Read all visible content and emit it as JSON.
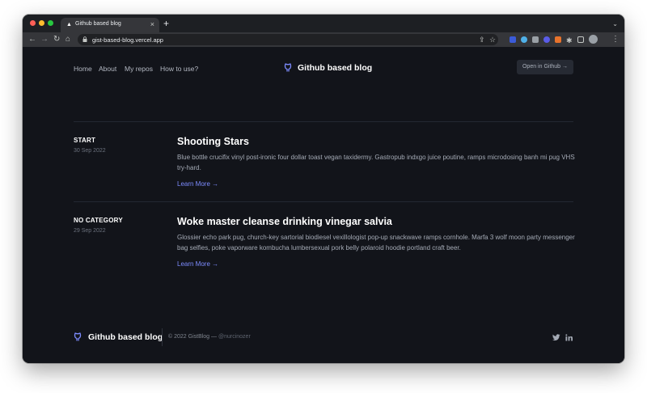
{
  "browser": {
    "tab_title": "Github based blog",
    "tab_favicon": "▲",
    "url": "gist-based-blog.vercel.app",
    "colors": {
      "close": "#ff5f57",
      "minimize": "#febc2e",
      "maximize": "#28c840"
    },
    "icons": [
      "back-icon",
      "forward-icon",
      "reload-icon",
      "home-icon",
      "lock-icon",
      "share-icon",
      "star-icon",
      "extensions-icon",
      "profile-avatar-icon"
    ]
  },
  "site": {
    "nav": [
      "Home",
      "About",
      "My repos",
      "How to use?"
    ],
    "brand": "Github based blog",
    "github_button": "Open in Github →",
    "accent": "#7d8cff"
  },
  "posts": [
    {
      "category": "START",
      "date": "30 Sep 2022",
      "title": "Shooting Stars",
      "excerpt": "Blue bottle crucifix vinyl post-ironic four dollar toast vegan taxidermy. Gastropub indxgo juice poutine, ramps microdosing banh mi pug VHS try-hard.",
      "link": "Learn More →"
    },
    {
      "category": "NO CATEGORY",
      "date": "29 Sep 2022",
      "title": "Woke master cleanse drinking vinegar salvia",
      "excerpt": "Glossier echo park pug, church-key sartorial biodiesel vexillologist pop-up snackwave ramps cornhole. Marfa 3 wolf moon party messenger bag selfies, poke vaporware kombucha lumbersexual pork belly polaroid hoodie portland craft beer.",
      "link": "Learn More →"
    }
  ],
  "footer": {
    "brand": "Github based blog",
    "copyright": "© 2022 GistBlog —",
    "handle": "@nurcinozer",
    "social": [
      "twitter-icon",
      "linkedin-icon"
    ]
  }
}
